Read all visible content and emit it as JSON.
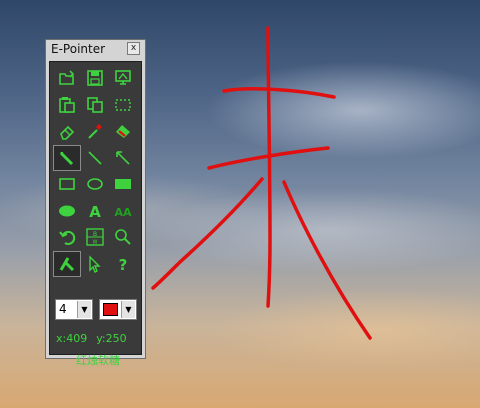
{
  "app": {
    "title": "E-Pointer",
    "close_label": "x"
  },
  "tools": [
    {
      "name": "open-icon",
      "label": "Open"
    },
    {
      "name": "save-icon",
      "label": "Save"
    },
    {
      "name": "screen-icon",
      "label": "Screen"
    },
    {
      "name": "paste-icon",
      "label": "Paste"
    },
    {
      "name": "copy-icon",
      "label": "Copy"
    },
    {
      "name": "select-rect-icon",
      "label": "Select"
    },
    {
      "name": "eraser-icon",
      "label": "Eraser"
    },
    {
      "name": "dropper-icon",
      "label": "Dropper"
    },
    {
      "name": "clear-icon",
      "label": "Clear"
    },
    {
      "name": "pencil-icon",
      "label": "Pencil",
      "active": true
    },
    {
      "name": "line-icon",
      "label": "Line"
    },
    {
      "name": "arrow-line-icon",
      "label": "Arrow"
    },
    {
      "name": "rect-icon",
      "label": "Rectangle"
    },
    {
      "name": "ellipse-icon",
      "label": "Ellipse"
    },
    {
      "name": "filled-rect-icon",
      "label": "Filled rectangle"
    },
    {
      "name": "filled-ellipse-icon",
      "label": "Filled ellipse"
    },
    {
      "name": "text-icon",
      "label": "A"
    },
    {
      "name": "text-style-icon",
      "label": "AA"
    },
    {
      "name": "undo-icon",
      "label": "Undo"
    },
    {
      "name": "board-icon",
      "label": "Board"
    },
    {
      "name": "magnifier-icon",
      "label": "Zoom"
    },
    {
      "name": "highlighter-icon",
      "label": "Highlighter"
    },
    {
      "name": "pointer-icon",
      "label": "Pointer"
    },
    {
      "name": "help-icon",
      "label": "?"
    }
  ],
  "controls": {
    "pen_size": "4",
    "pen_color": "#e01010",
    "dropdown_symbol": "▼"
  },
  "status": {
    "x": "x:409",
    "y": "y:250",
    "caption": "红烛软糖"
  },
  "colors": {
    "accent": "#3fd23f",
    "stroke": "#e01010"
  }
}
